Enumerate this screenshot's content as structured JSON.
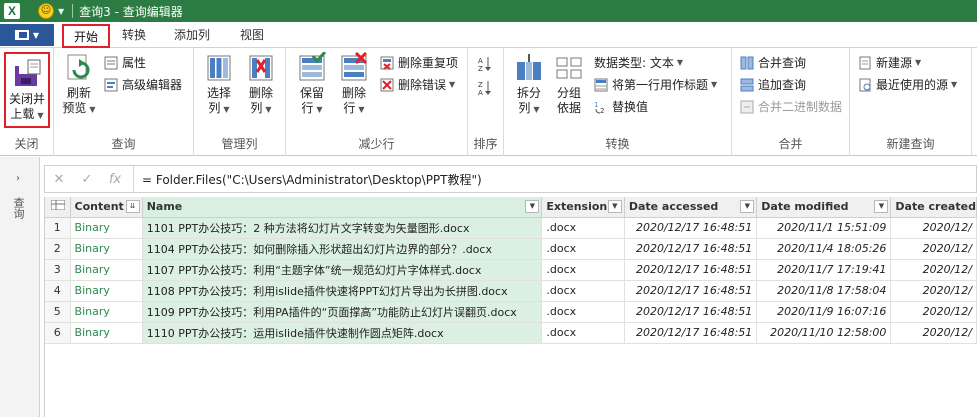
{
  "window": {
    "title": "查询3 - 查询编辑器",
    "app_icon": "X"
  },
  "tabs": [
    {
      "label": "开始",
      "active": true
    },
    {
      "label": "转换"
    },
    {
      "label": "添加列"
    },
    {
      "label": "视图"
    }
  ],
  "ribbon": {
    "close": {
      "button": "关闭并上载",
      "line1": "关闭并",
      "line2": "上载",
      "group": "关闭"
    },
    "query": {
      "refresh_line1": "刷新",
      "refresh_line2": "预览",
      "properties": "属性",
      "advanced_editor": "高级编辑器",
      "group": "查询"
    },
    "manage_columns": {
      "choose_line1": "选择",
      "choose_line2": "列",
      "remove_line1": "删除",
      "remove_line2": "列",
      "group": "管理列"
    },
    "reduce_rows": {
      "keep_line1": "保留",
      "keep_line2": "行",
      "remove_line1": "删除",
      "remove_line2": "行",
      "remove_duplicates": "删除重复项",
      "remove_errors": "删除错误",
      "group": "减少行"
    },
    "sort": {
      "group": "排序"
    },
    "transform": {
      "split_line1": "拆分",
      "split_line2": "列",
      "group_line1": "分组",
      "group_line2": "依据",
      "data_type": "数据类型: 文本",
      "first_row_header": "将第一行用作标题",
      "replace_values": "替换值",
      "group": "转换"
    },
    "combine": {
      "merge_queries": "合并查询",
      "append_queries": "追加查询",
      "combine_binaries": "合并二进制数据",
      "group": "合并"
    },
    "new_query": {
      "new_source": "新建源",
      "recent_sources": "最近使用的源",
      "group": "新建查询"
    }
  },
  "left_pane": {
    "label": "查询"
  },
  "formula": {
    "fx": "fx",
    "text": "= Folder.Files(\"C:\\Users\\Administrator\\Desktop\\PPT教程\")"
  },
  "table": {
    "columns": [
      "Content",
      "Name",
      "Extension",
      "Date accessed",
      "Date modified",
      "Date created"
    ],
    "rows": [
      {
        "n": "1",
        "content": "Binary",
        "name": "1101   PPT办公技巧：2 种方法将幻灯片文字转变为矢量图形.docx",
        "ext": ".docx",
        "accessed": "2020/12/17 16:48:51",
        "modified": "2020/11/1 15:51:09",
        "created": "2020/12/"
      },
      {
        "n": "2",
        "content": "Binary",
        "name": "1104   PPT办公技巧：如何删除插入形状超出幻灯片边界的部分？.docx",
        "ext": ".docx",
        "accessed": "2020/12/17 16:48:51",
        "modified": "2020/11/4 18:05:26",
        "created": "2020/12/"
      },
      {
        "n": "3",
        "content": "Binary",
        "name": "1107   PPT办公技巧：利用“主题字体”统一规范幻灯片字体样式.docx",
        "ext": ".docx",
        "accessed": "2020/12/17 16:48:51",
        "modified": "2020/11/7 17:19:41",
        "created": "2020/12/"
      },
      {
        "n": "4",
        "content": "Binary",
        "name": "1108   PPT办公技巧：利用islide插件快速将PPT幻灯片导出为长拼图.docx",
        "ext": ".docx",
        "accessed": "2020/12/17 16:48:51",
        "modified": "2020/11/8 17:58:04",
        "created": "2020/12/"
      },
      {
        "n": "5",
        "content": "Binary",
        "name": "1109   PPT办公技巧：利用PA插件的“页面撑高”功能防止幻灯片误翻页.docx",
        "ext": ".docx",
        "accessed": "2020/12/17 16:48:51",
        "modified": "2020/11/9 16:07:16",
        "created": "2020/12/"
      },
      {
        "n": "6",
        "content": "Binary",
        "name": "1110   PPT办公技巧：运用islide插件快速制作圆点矩阵.docx",
        "ext": ".docx",
        "accessed": "2020/12/17 16:48:51",
        "modified": "2020/11/10 12:58:00",
        "created": "2020/12/"
      }
    ]
  },
  "colors": {
    "title_bar": "#2b7b43",
    "file_tab": "#2b579a",
    "highlight": "#e0202a",
    "binary_text": "#2d8a4e",
    "selected_col": "#dbf0e3"
  }
}
